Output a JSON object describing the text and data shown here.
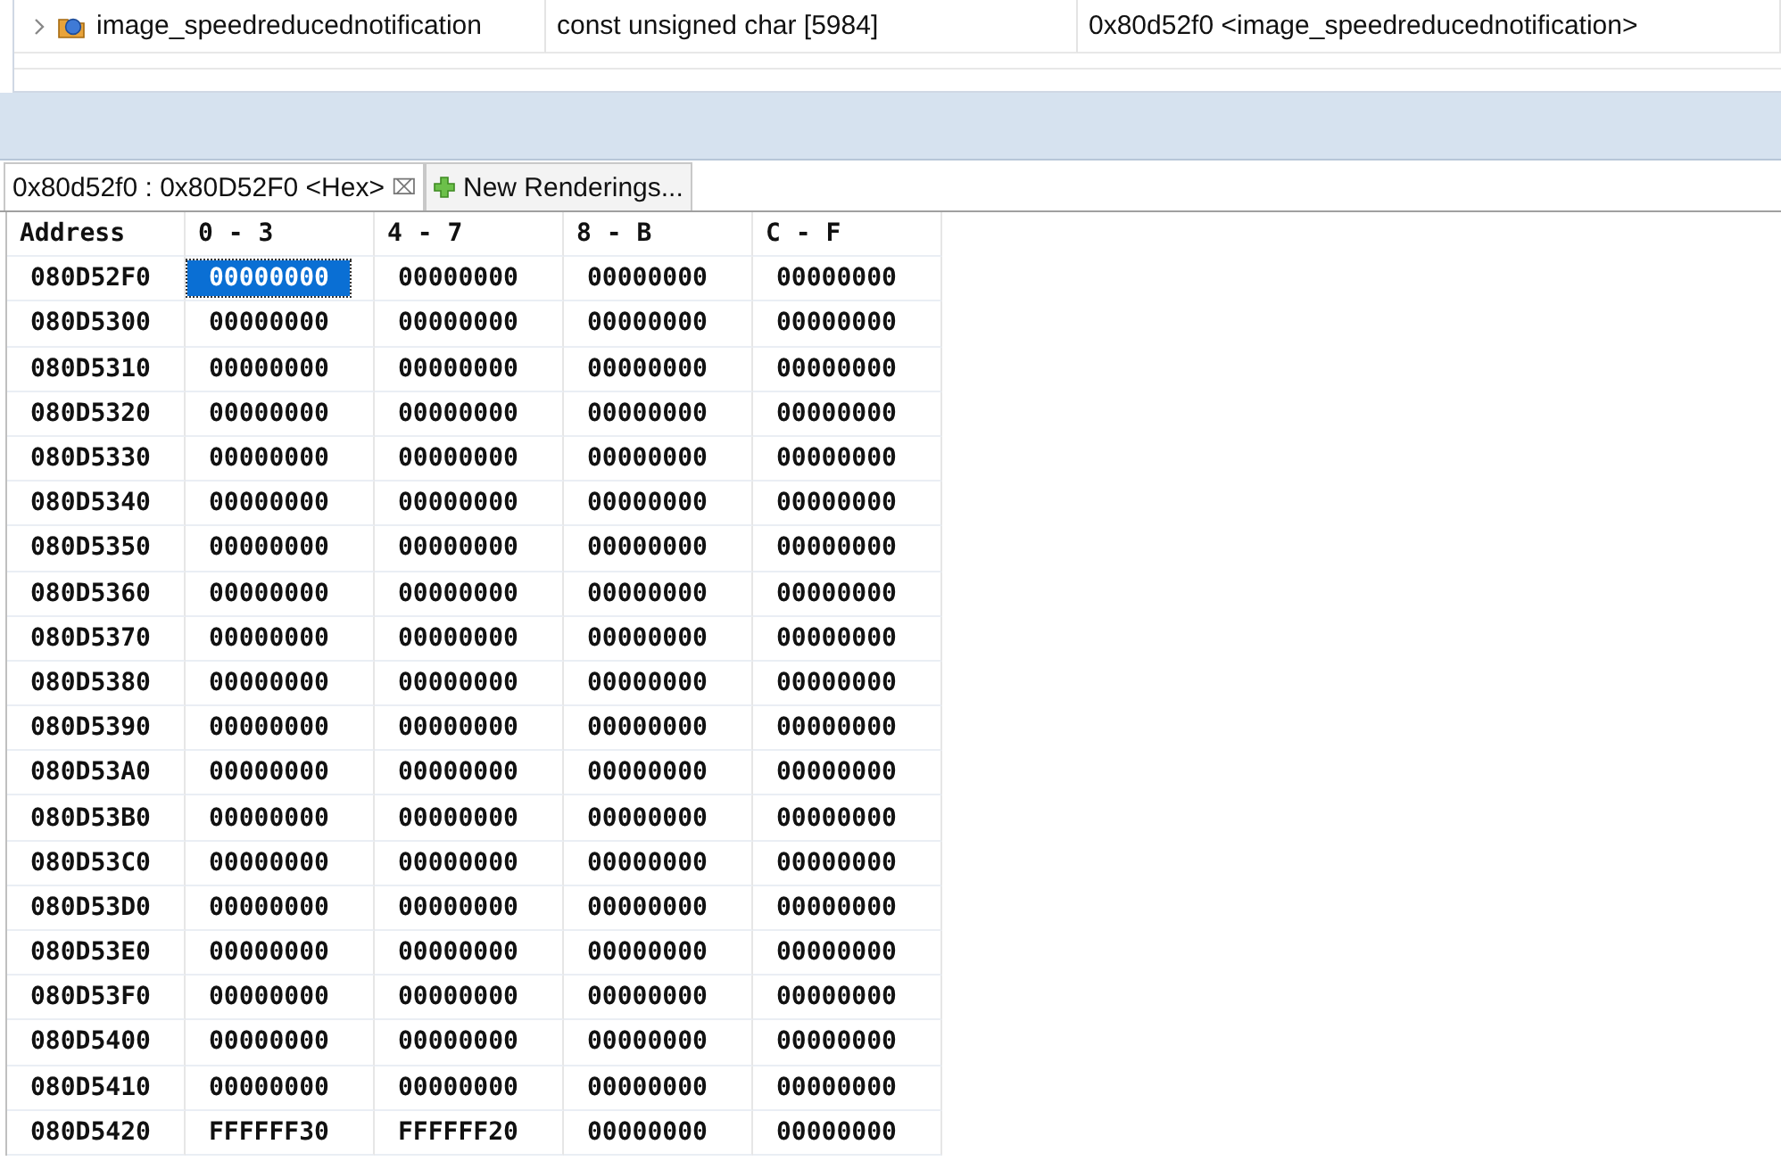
{
  "expressions": {
    "rows": [
      {
        "name": "image_speedreducednotification",
        "type": "const unsigned char [5984]",
        "value": "0x80d52f0 <image_speedreducednotification>",
        "expanded": false
      }
    ]
  },
  "tabs": [
    {
      "kind": "rendering",
      "label": "0x80d52f0 : 0x80D52F0 <Hex>",
      "selected": true,
      "close": "⌧"
    },
    {
      "kind": "new",
      "label": "New Renderings...",
      "selected": false
    }
  ],
  "memory": {
    "columns": [
      "Address",
      "0 - 3",
      "4 - 7",
      "8 - B",
      "C - F"
    ],
    "rows": [
      {
        "cells": [
          {
            "text": "080D52F0",
            "selected": false
          },
          {
            "text": "00000000",
            "selected": true
          },
          {
            "text": "00000000",
            "selected": false
          },
          {
            "text": "00000000",
            "selected": false
          },
          {
            "text": "00000000",
            "selected": false
          }
        ]
      },
      {
        "cells": [
          {
            "text": "080D5300",
            "selected": false
          },
          {
            "text": "00000000",
            "selected": false
          },
          {
            "text": "00000000",
            "selected": false
          },
          {
            "text": "00000000",
            "selected": false
          },
          {
            "text": "00000000",
            "selected": false
          }
        ]
      },
      {
        "cells": [
          {
            "text": "080D5310",
            "selected": false
          },
          {
            "text": "00000000",
            "selected": false
          },
          {
            "text": "00000000",
            "selected": false
          },
          {
            "text": "00000000",
            "selected": false
          },
          {
            "text": "00000000",
            "selected": false
          }
        ]
      },
      {
        "cells": [
          {
            "text": "080D5320",
            "selected": false
          },
          {
            "text": "00000000",
            "selected": false
          },
          {
            "text": "00000000",
            "selected": false
          },
          {
            "text": "00000000",
            "selected": false
          },
          {
            "text": "00000000",
            "selected": false
          }
        ]
      },
      {
        "cells": [
          {
            "text": "080D5330",
            "selected": false
          },
          {
            "text": "00000000",
            "selected": false
          },
          {
            "text": "00000000",
            "selected": false
          },
          {
            "text": "00000000",
            "selected": false
          },
          {
            "text": "00000000",
            "selected": false
          }
        ]
      },
      {
        "cells": [
          {
            "text": "080D5340",
            "selected": false
          },
          {
            "text": "00000000",
            "selected": false
          },
          {
            "text": "00000000",
            "selected": false
          },
          {
            "text": "00000000",
            "selected": false
          },
          {
            "text": "00000000",
            "selected": false
          }
        ]
      },
      {
        "cells": [
          {
            "text": "080D5350",
            "selected": false
          },
          {
            "text": "00000000",
            "selected": false
          },
          {
            "text": "00000000",
            "selected": false
          },
          {
            "text": "00000000",
            "selected": false
          },
          {
            "text": "00000000",
            "selected": false
          }
        ]
      },
      {
        "cells": [
          {
            "text": "080D5360",
            "selected": false
          },
          {
            "text": "00000000",
            "selected": false
          },
          {
            "text": "00000000",
            "selected": false
          },
          {
            "text": "00000000",
            "selected": false
          },
          {
            "text": "00000000",
            "selected": false
          }
        ]
      },
      {
        "cells": [
          {
            "text": "080D5370",
            "selected": false
          },
          {
            "text": "00000000",
            "selected": false
          },
          {
            "text": "00000000",
            "selected": false
          },
          {
            "text": "00000000",
            "selected": false
          },
          {
            "text": "00000000",
            "selected": false
          }
        ]
      },
      {
        "cells": [
          {
            "text": "080D5380",
            "selected": false
          },
          {
            "text": "00000000",
            "selected": false
          },
          {
            "text": "00000000",
            "selected": false
          },
          {
            "text": "00000000",
            "selected": false
          },
          {
            "text": "00000000",
            "selected": false
          }
        ]
      },
      {
        "cells": [
          {
            "text": "080D5390",
            "selected": false
          },
          {
            "text": "00000000",
            "selected": false
          },
          {
            "text": "00000000",
            "selected": false
          },
          {
            "text": "00000000",
            "selected": false
          },
          {
            "text": "00000000",
            "selected": false
          }
        ]
      },
      {
        "cells": [
          {
            "text": "080D53A0",
            "selected": false
          },
          {
            "text": "00000000",
            "selected": false
          },
          {
            "text": "00000000",
            "selected": false
          },
          {
            "text": "00000000",
            "selected": false
          },
          {
            "text": "00000000",
            "selected": false
          }
        ]
      },
      {
        "cells": [
          {
            "text": "080D53B0",
            "selected": false
          },
          {
            "text": "00000000",
            "selected": false
          },
          {
            "text": "00000000",
            "selected": false
          },
          {
            "text": "00000000",
            "selected": false
          },
          {
            "text": "00000000",
            "selected": false
          }
        ]
      },
      {
        "cells": [
          {
            "text": "080D53C0",
            "selected": false
          },
          {
            "text": "00000000",
            "selected": false
          },
          {
            "text": "00000000",
            "selected": false
          },
          {
            "text": "00000000",
            "selected": false
          },
          {
            "text": "00000000",
            "selected": false
          }
        ]
      },
      {
        "cells": [
          {
            "text": "080D53D0",
            "selected": false
          },
          {
            "text": "00000000",
            "selected": false
          },
          {
            "text": "00000000",
            "selected": false
          },
          {
            "text": "00000000",
            "selected": false
          },
          {
            "text": "00000000",
            "selected": false
          }
        ]
      },
      {
        "cells": [
          {
            "text": "080D53E0",
            "selected": false
          },
          {
            "text": "00000000",
            "selected": false
          },
          {
            "text": "00000000",
            "selected": false
          },
          {
            "text": "00000000",
            "selected": false
          },
          {
            "text": "00000000",
            "selected": false
          }
        ]
      },
      {
        "cells": [
          {
            "text": "080D53F0",
            "selected": false
          },
          {
            "text": "00000000",
            "selected": false
          },
          {
            "text": "00000000",
            "selected": false
          },
          {
            "text": "00000000",
            "selected": false
          },
          {
            "text": "00000000",
            "selected": false
          }
        ]
      },
      {
        "cells": [
          {
            "text": "080D5400",
            "selected": false
          },
          {
            "text": "00000000",
            "selected": false
          },
          {
            "text": "00000000",
            "selected": false
          },
          {
            "text": "00000000",
            "selected": false
          },
          {
            "text": "00000000",
            "selected": false
          }
        ]
      },
      {
        "cells": [
          {
            "text": "080D5410",
            "selected": false
          },
          {
            "text": "00000000",
            "selected": false
          },
          {
            "text": "00000000",
            "selected": false
          },
          {
            "text": "00000000",
            "selected": false
          },
          {
            "text": "00000000",
            "selected": false
          }
        ]
      },
      {
        "cells": [
          {
            "text": "080D5420",
            "selected": false
          },
          {
            "text": "FFFFFF30",
            "selected": false
          },
          {
            "text": "FFFFFF20",
            "selected": false
          },
          {
            "text": "00000000",
            "selected": false
          },
          {
            "text": "00000000",
            "selected": false
          }
        ]
      }
    ]
  }
}
